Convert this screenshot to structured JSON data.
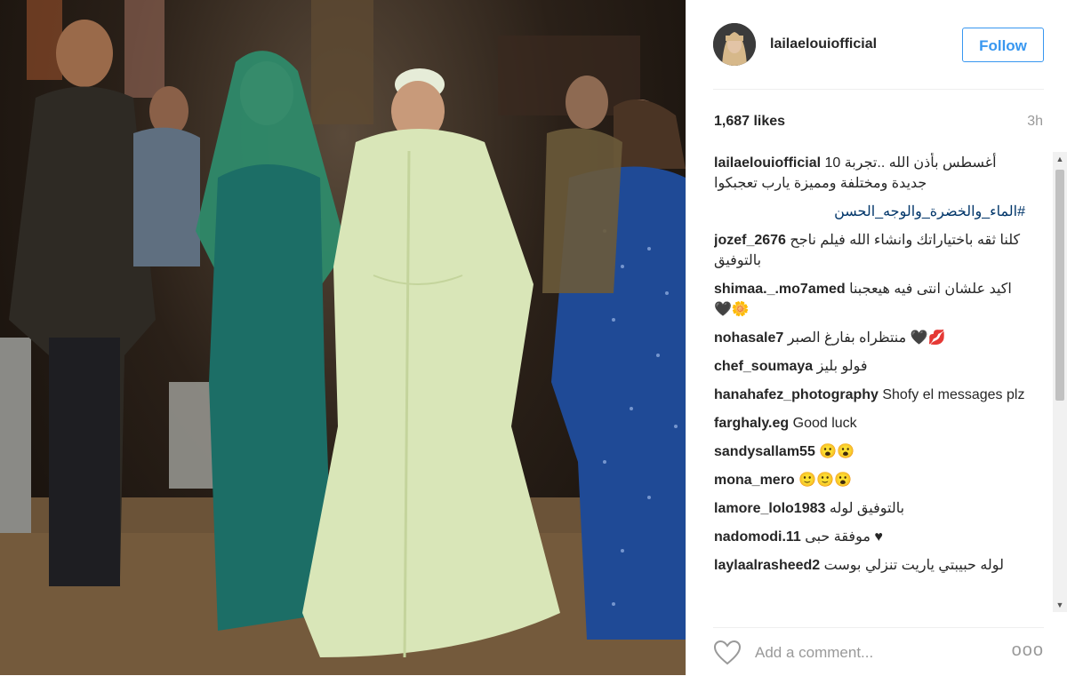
{
  "post": {
    "username": "lailaelouiofficial",
    "follow_label": "Follow",
    "likes": "1,687 likes",
    "time": "3h"
  },
  "caption": {
    "username": "lailaelouiofficial",
    "text": "أغسطس بأذن الله ..تجربة 10 جديدة ومختلفة ومميزة يارب تعجبكوا",
    "hashtag": "#الماء_والخضرة_والوجه_الحسن"
  },
  "comments": [
    {
      "user": "jozef_2676",
      "text": "كلنا ثقه باختياراتك وانشاء الله فيلم ناجح بالتوفيق",
      "rtl": true
    },
    {
      "user": "shimaa._.mo7amed",
      "text": "اكيد علشان انتى فيه هيعجبنا 🖤🌼",
      "rtl": true
    },
    {
      "user": "nohasale7",
      "text": "منتظراه بفارغ الصبر 🖤💋",
      "rtl": true
    },
    {
      "user": "chef_soumaya",
      "text": "فولو بليز",
      "rtl": true
    },
    {
      "user": "hanahafez_photography",
      "text": "Shofy el messages plz",
      "rtl": false
    },
    {
      "user": "farghaly.eg",
      "text": "Good luck",
      "rtl": false
    },
    {
      "user": "sandysallam55",
      "text": "😮😮",
      "rtl": false
    },
    {
      "user": "mona_mero",
      "text": "🙂🙂😮",
      "rtl": false
    },
    {
      "user": "lamore_lolo1983",
      "text": "بالتوفيق لوله",
      "rtl": true
    },
    {
      "user": "nadomodi.11",
      "text": "موفقة حبى ♥",
      "rtl": true
    },
    {
      "user": "laylaalrasheed2",
      "text": "لوله حبيبتي ياريت تنزلي بوست",
      "rtl": true
    }
  ],
  "footer": {
    "add_comment_placeholder": "Add a comment...",
    "more_label": "ooo"
  },
  "icons": {
    "heart": "heart-icon",
    "more": "more-options-icon",
    "scroll_up": "scroll-up-arrow-icon",
    "scroll_down": "scroll-down-arrow-icon"
  },
  "colors": {
    "follow_blue": "#3897f0",
    "hashtag": "#003569",
    "muted": "#999999"
  }
}
